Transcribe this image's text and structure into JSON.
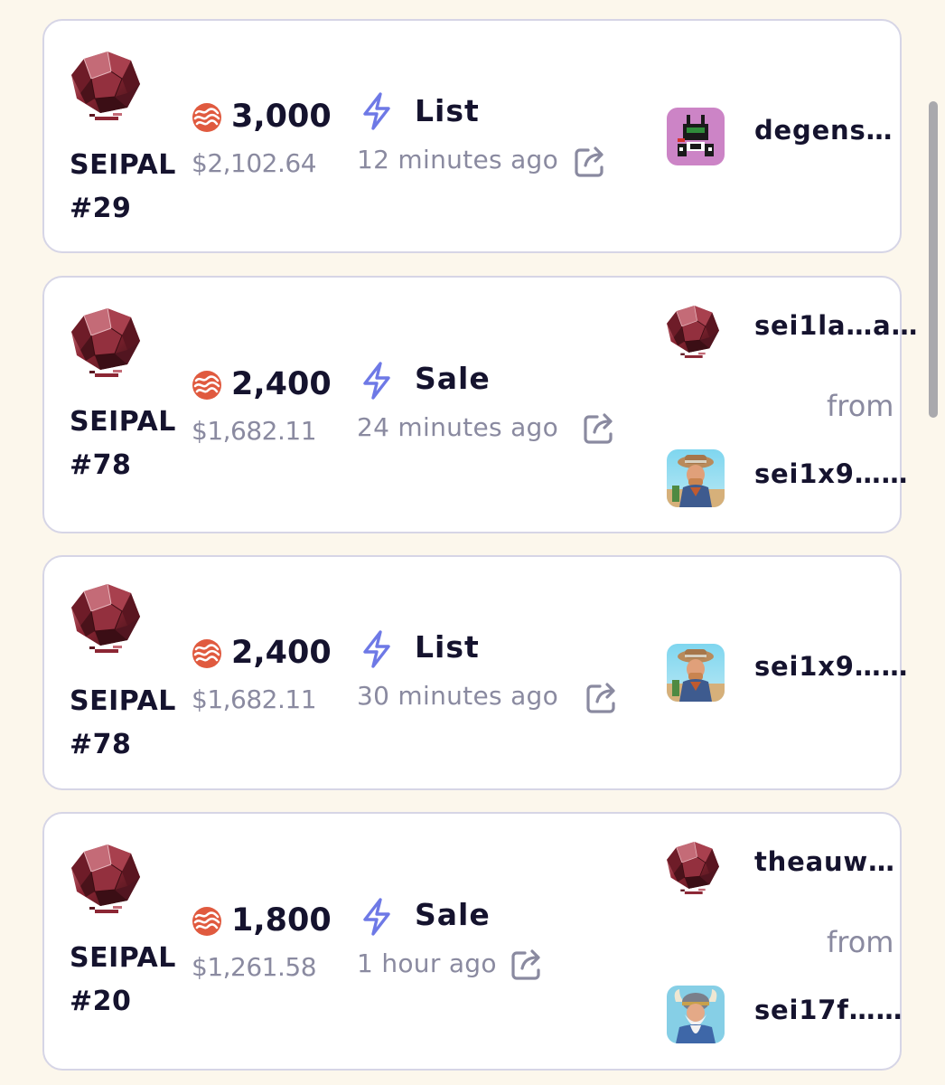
{
  "activities": [
    {
      "nft_name": "SEIPAL",
      "nft_number": "#29",
      "price": "3,000",
      "usd": "$2,102.64",
      "event": "List",
      "time": "12 minutes ago",
      "user": "degens…"
    },
    {
      "nft_name": "SEIPAL",
      "nft_number": "#78",
      "price": "2,400",
      "usd": "$1,682.11",
      "event": "Sale",
      "time": "24 minutes ago",
      "buyer": "sei1la…a…",
      "from_label": "from",
      "seller": "sei1x9……"
    },
    {
      "nft_name": "SEIPAL",
      "nft_number": "#78",
      "price": "2,400",
      "usd": "$1,682.11",
      "event": "List",
      "time": "30 minutes ago",
      "user": "sei1x9……"
    },
    {
      "nft_name": "SEIPAL",
      "nft_number": "#20",
      "price": "1,800",
      "usd": "$1,261.58",
      "event": "Sale",
      "time": "1 hour ago",
      "buyer": "theauw…",
      "from_label": "from",
      "seller": "sei17f……"
    }
  ],
  "icons": {
    "currency": "sei-logo-icon",
    "event": "lightning-bolt-icon",
    "share": "external-share-icon"
  },
  "colors": {
    "background": "#fcf7ec",
    "card_border": "#d6d5e6",
    "sei_red": "#e05a3f",
    "bolt_blue": "#6e79e6",
    "muted_text": "#8a8aa0",
    "primary_text": "#15132e"
  }
}
